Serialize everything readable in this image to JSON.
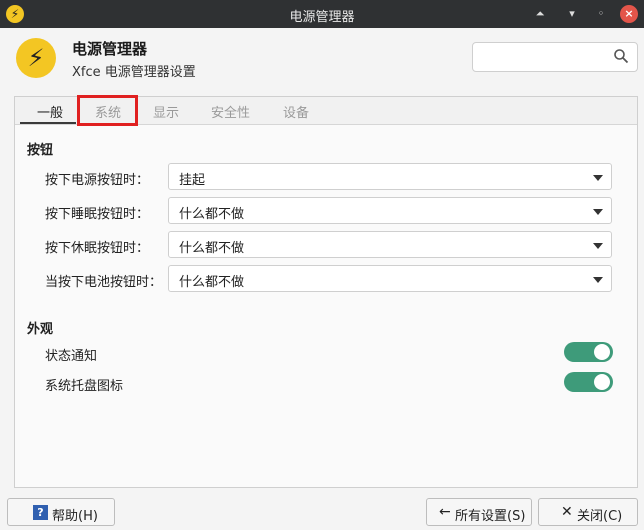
{
  "window": {
    "title": "电源管理器",
    "icon": "lightning-icon",
    "controls": [
      "window-up-icon",
      "minimize-icon",
      "maximize-icon",
      "close-icon"
    ]
  },
  "header": {
    "title": "电源管理器",
    "subtitle": "Xfce 电源管理器设置",
    "icon": "lightning-icon",
    "search": {
      "value": "",
      "placeholder": "",
      "icon": "search-icon"
    }
  },
  "tabs": [
    {
      "label": "一般",
      "active": true
    },
    {
      "label": "系统",
      "active": false,
      "highlighted": true
    },
    {
      "label": "显示",
      "active": false
    },
    {
      "label": "安全性",
      "active": false
    },
    {
      "label": "设备",
      "active": false
    }
  ],
  "buttons_section": {
    "title": "按钮",
    "rows": [
      {
        "label": "按下电源按钮时：",
        "value": "挂起"
      },
      {
        "label": "按下睡眠按钮时：",
        "value": "什么都不做"
      },
      {
        "label": "按下休眠按钮时：",
        "value": "什么都不做"
      },
      {
        "label": "当按下电池按钮时：",
        "value": "什么都不做"
      }
    ]
  },
  "appearance_section": {
    "title": "外观",
    "rows": [
      {
        "label": "状态通知",
        "enabled": true
      },
      {
        "label": "系统托盘图标",
        "enabled": true
      }
    ]
  },
  "footer": {
    "help_label": "帮助(H)",
    "all_settings_label": "所有设置(S)",
    "close_label": "关闭(C)"
  },
  "colors": {
    "accent_toggle": "#3e9b7a",
    "app_icon": "#f3c623",
    "highlight_box": "#e02020",
    "close_button": "#e3554a"
  }
}
